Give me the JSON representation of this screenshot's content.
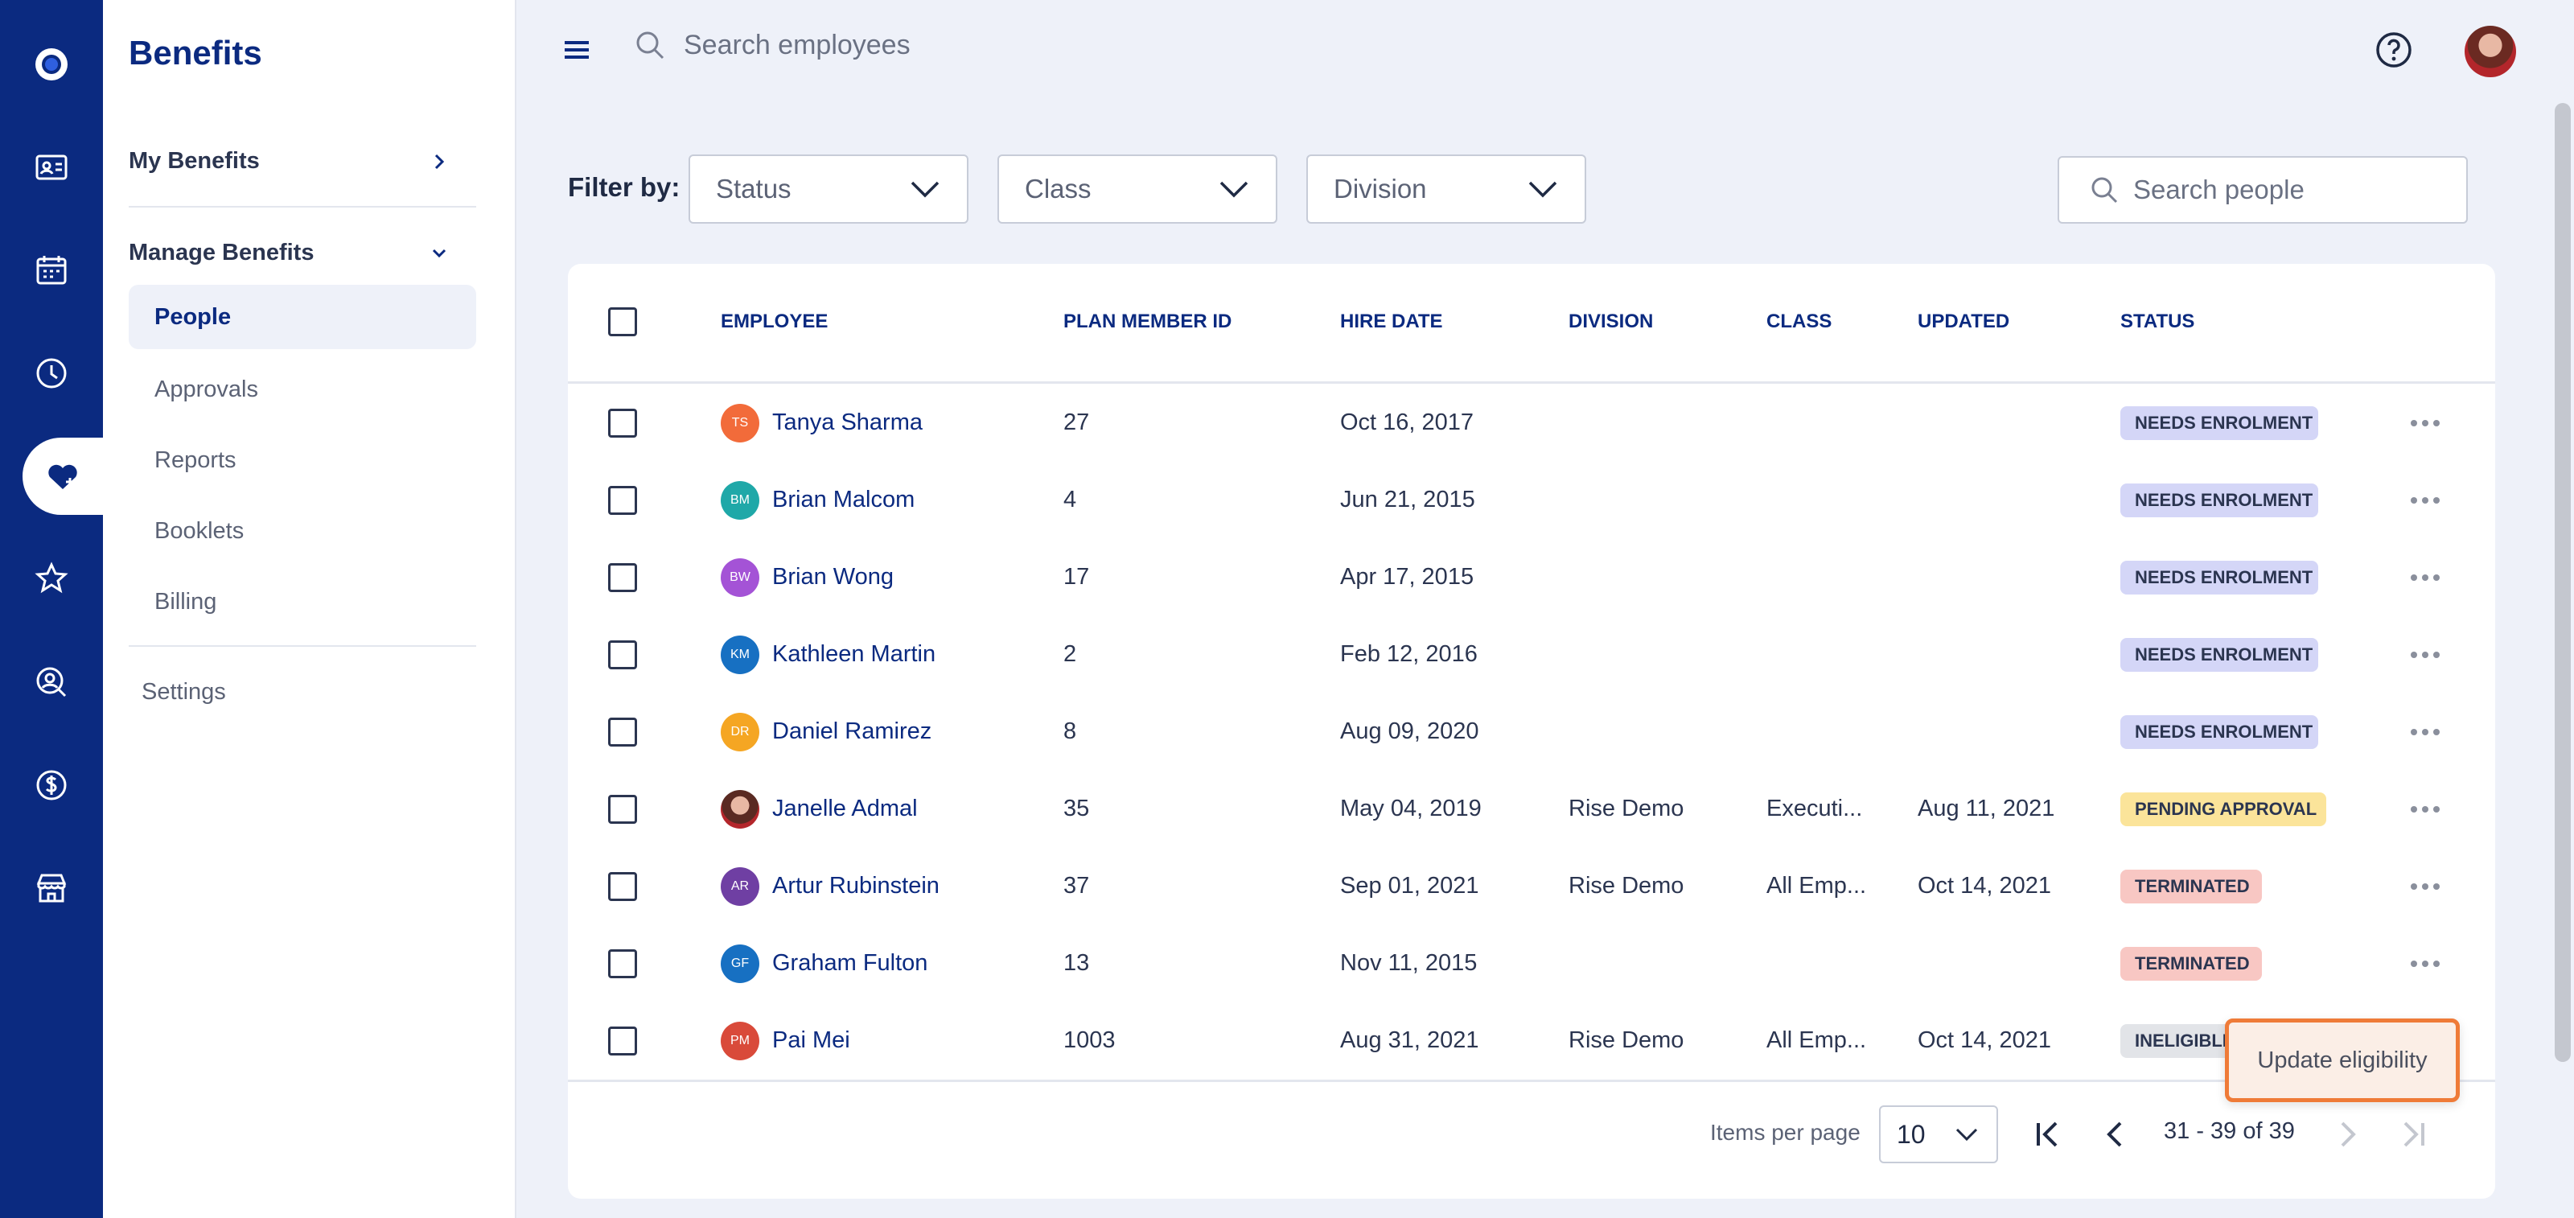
{
  "app": {
    "title": "Benefits"
  },
  "nav": {
    "my_benefits": "My Benefits",
    "manage_benefits": "Manage Benefits",
    "items": [
      "People",
      "Approvals",
      "Reports",
      "Booklets",
      "Billing"
    ],
    "active_item": "People",
    "settings": "Settings"
  },
  "header": {
    "search_placeholder": "Search employees"
  },
  "filters": {
    "label": "Filter by:",
    "status": "Status",
    "class": "Class",
    "division": "Division",
    "search_placeholder": "Search people"
  },
  "table": {
    "columns": [
      "EMPLOYEE",
      "PLAN MEMBER ID",
      "HIRE DATE",
      "DIVISION",
      "CLASS",
      "UPDATED",
      "STATUS"
    ],
    "rows": [
      {
        "initials": "TS",
        "name": "Tanya Sharma",
        "id": "27",
        "hire": "Oct 16, 2017",
        "division": "",
        "class": "",
        "updated": "",
        "status": "NEEDS ENROLMENT",
        "avatar_color": "#f26b3a"
      },
      {
        "initials": "BM",
        "name": "Brian Malcom",
        "id": "4",
        "hire": "Jun 21, 2015",
        "division": "",
        "class": "",
        "updated": "",
        "status": "NEEDS ENROLMENT",
        "avatar_color": "#1fa8a8"
      },
      {
        "initials": "BW",
        "name": "Brian Wong",
        "id": "17",
        "hire": "Apr 17, 2015",
        "division": "",
        "class": "",
        "updated": "",
        "status": "NEEDS ENROLMENT",
        "avatar_color": "#a453d6"
      },
      {
        "initials": "KM",
        "name": "Kathleen Martin",
        "id": "2",
        "hire": "Feb 12, 2016",
        "division": "",
        "class": "",
        "updated": "",
        "status": "NEEDS ENROLMENT",
        "avatar_color": "#1770c2"
      },
      {
        "initials": "DR",
        "name": "Daniel Ramirez",
        "id": "8",
        "hire": "Aug 09, 2020",
        "division": "",
        "class": "",
        "updated": "",
        "status": "NEEDS ENROLMENT",
        "avatar_color": "#f5a623"
      },
      {
        "initials": "",
        "name": "Janelle Admal",
        "id": "35",
        "hire": "May 04, 2019",
        "division": "Rise Demo",
        "class": "Executi...",
        "updated": "Aug 11, 2021",
        "status": "PENDING APPROVAL",
        "avatar_color": "#7a3b2e"
      },
      {
        "initials": "AR",
        "name": "Artur Rubinstein",
        "id": "37",
        "hire": "Sep 01, 2021",
        "division": "Rise Demo",
        "class": "All Emp...",
        "updated": "Oct 14, 2021",
        "status": "TERMINATED",
        "avatar_color": "#6f3fa3"
      },
      {
        "initials": "GF",
        "name": "Graham Fulton",
        "id": "13",
        "hire": "Nov 11, 2015",
        "division": "",
        "class": "",
        "updated": "",
        "status": "TERMINATED",
        "avatar_color": "#1770c2"
      },
      {
        "initials": "PM",
        "name": "Pai Mei",
        "id": "1003",
        "hire": "Aug 31, 2021",
        "division": "Rise Demo",
        "class": "All Emp...",
        "updated": "Oct 14, 2021",
        "status": "INELIGIBLE",
        "avatar_color": "#d94a3a"
      }
    ]
  },
  "status_colors": {
    "NEEDS ENROLMENT": "#d4d6f7",
    "PENDING APPROVAL": "#fbe49a",
    "TERMINATED": "#f8c7c3",
    "INELIGIBLE": "#e2e4e8"
  },
  "pagination": {
    "items_per_page_label": "Items per page",
    "items_per_page": "10",
    "range": "31 - 39 of 39"
  },
  "popup": {
    "label": "Update eligibility"
  },
  "colors": {
    "brand": "#0b2a80",
    "highlight": "#ef7b38"
  }
}
